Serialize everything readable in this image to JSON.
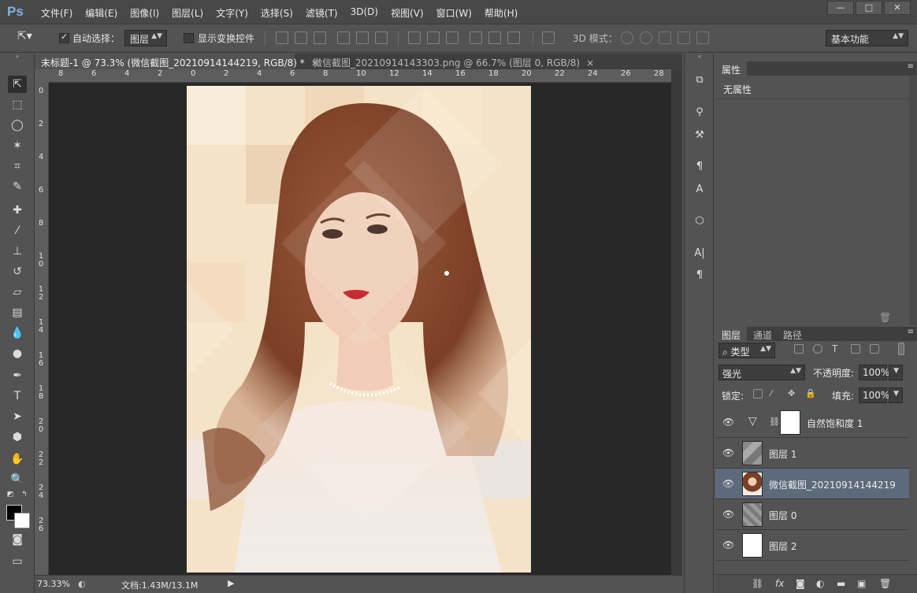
{
  "app": {
    "logo": "Ps",
    "menu": [
      "文件(F)",
      "编辑(E)",
      "图像(I)",
      "图层(L)",
      "文字(Y)",
      "选择(S)",
      "滤镜(T)",
      "3D(D)",
      "视图(V)",
      "窗口(W)",
      "帮助(H)"
    ],
    "window_controls": [
      "—",
      "□",
      "✕"
    ]
  },
  "options_bar": {
    "auto_select_label": "自动选择：",
    "auto_select_checked": true,
    "auto_select_target": "图层",
    "show_transform_label": "显示变换控件",
    "show_transform_checked": false,
    "mode_3d_label": "3D 模式：",
    "workspace": "基本功能"
  },
  "documents": {
    "tabs": [
      {
        "label": "未标题-1 @ 73.3% (微信截图_20210914144219, RGB/8) *",
        "active": true
      },
      {
        "label": "微信截图_20210914143303.png @ 66.7% (图层 0, RGB/8)",
        "active": false
      }
    ]
  },
  "rulers": {
    "horizontal": [
      "8",
      "6",
      "4",
      "2",
      "0",
      "2",
      "4",
      "6",
      "8",
      "10",
      "12",
      "14",
      "16",
      "18",
      "20",
      "22",
      "24",
      "26",
      "28"
    ],
    "vertical": [
      "0",
      "2",
      "4",
      "6",
      "8",
      "1\n0",
      "1\n2",
      "1\n4",
      "1\n6",
      "1\n8",
      "2\n0",
      "2\n2",
      "2\n4",
      "2\n6"
    ]
  },
  "status_bar": {
    "zoom": "73.33%",
    "doc_info": "文档:1.43M/13.1M"
  },
  "properties_panel": {
    "tab": "属性",
    "empty_text": "无属性"
  },
  "layers_panel": {
    "tabs": [
      "图层",
      "通道",
      "路径"
    ],
    "filter_label": "类型",
    "blend_mode": "强光",
    "opacity_label": "不透明度:",
    "opacity": "100%",
    "lock_label": "锁定:",
    "fill_label": "填充:",
    "fill": "100%",
    "layers": [
      {
        "name": "自然饱和度 1",
        "kind": "adjustment",
        "visible": true,
        "selected": false
      },
      {
        "name": "图层 1",
        "kind": "pattern",
        "visible": true,
        "selected": false
      },
      {
        "name": "微信截图_20210914144219",
        "kind": "photo",
        "visible": true,
        "selected": true
      },
      {
        "name": "图层 0",
        "kind": "pattern",
        "visible": true,
        "selected": false
      },
      {
        "name": "图层 2",
        "kind": "white",
        "visible": true,
        "selected": false
      }
    ]
  },
  "colors": {
    "foreground": "#000000",
    "background": "#ffffff",
    "selection": "#5d6a7c"
  }
}
